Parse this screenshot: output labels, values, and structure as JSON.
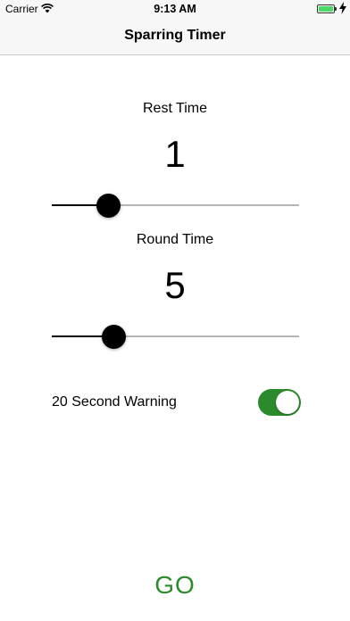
{
  "status_bar": {
    "carrier": "Carrier",
    "time": "9:13 AM",
    "battery_color": "#4cd964"
  },
  "nav": {
    "title": "Sparring Timer"
  },
  "rest": {
    "label": "Rest Time",
    "value": "1",
    "slider_fraction": 0.23
  },
  "round": {
    "label": "Round Time",
    "value": "5",
    "slider_fraction": 0.25
  },
  "warning": {
    "label": "20 Second Warning",
    "enabled": true
  },
  "go": {
    "label": "GO",
    "color": "#2b8a2b"
  }
}
